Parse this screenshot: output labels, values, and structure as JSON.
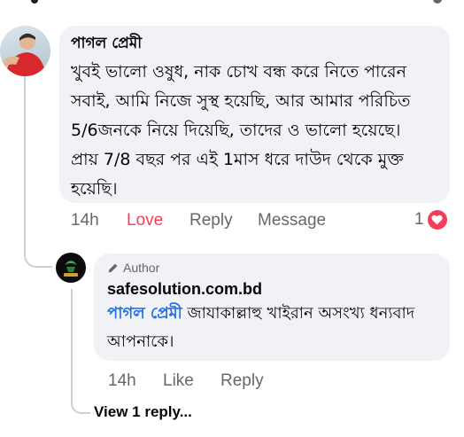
{
  "comment": {
    "author": "পাগল প্রেমী",
    "text": "খুবই  ভালো ওষুধ, নাক চোখ বন্ধ করে নিতে পারেন সবাই, আমি নিজে সুস্থ হয়েছি, আর আমার পরিচিত 5/6জনকে নিয়ে দিয়েছি, তাদের ও ভালো হয়েছে। প্রায় 7/8 বছর পর এই 1মাস ধরে দাউদ থেকে মুক্ত হয়েছি।",
    "time": "14h",
    "reaction_label": "Love",
    "reply_label": "Reply",
    "message_label": "Message",
    "reaction_count": "1",
    "colors": {
      "love": "#f33e58",
      "meta": "#65676b"
    }
  },
  "reply": {
    "badge": "Author",
    "author": "safesolution.com.bd",
    "mention": "পাগল প্রেমী",
    "text": " জাযাকাল্লাহু খাইরান অসংখ্য ধন্যবাদ আপনাকে।",
    "time": "14h",
    "like_label": "Like",
    "reply_label": "Reply",
    "colors": {
      "mention": "#216fdb"
    }
  },
  "view_replies_label": "View 1 reply..."
}
